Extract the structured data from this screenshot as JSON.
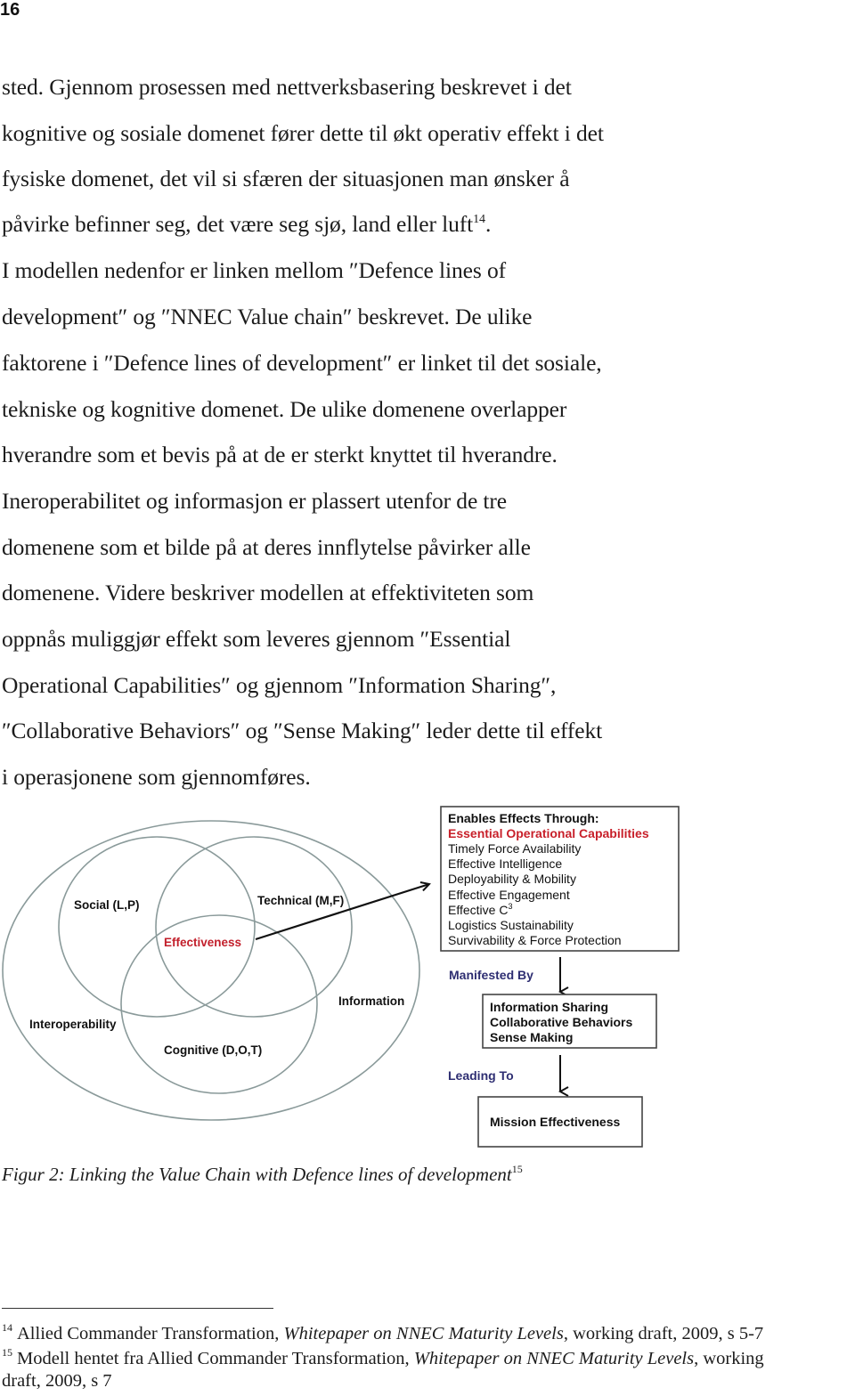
{
  "page": {
    "number": "16"
  },
  "body_lines": [
    "sted. Gjennom prosessen med nettverksbasering beskrevet i det",
    "kognitive og sosiale domenet fører dette til økt operativ effekt i det",
    "fysiske domenet, det vil si sfæren der situasjonen man ønsker å",
    "påvirke befinner seg, det være seg sjø, land eller luft",
    "I modellen nedenfor er linken mellom ″Defence lines of",
    "development″ og ″NNEC Value chain″ beskrevet. De ulike",
    "faktorene i ″Defence lines of development″ er linket til det sosiale,",
    "tekniske og kognitive domenet. De ulike domenene overlapper",
    "hverandre som et bevis på at de er sterkt knyttet til hverandre.",
    "Ineroperabilitet og informasjon er plassert utenfor de tre",
    "domenene som et bilde på at deres innflytelse påvirker alle",
    "domenene. Videre beskriver modellen at effektiviteten som",
    "oppnås muliggjør effekt som leveres gjennom ″Essential",
    "Operational Capabilities″ og gjennom ″Information Sharing″,",
    "″Collaborative Behaviors″ og ″Sense Making″ leder dette til effekt",
    "i operasjonene som gjennomføres."
  ],
  "body_footnote_ref": {
    "marker": "14",
    "after_text": "."
  },
  "figure": {
    "venn": {
      "social": "Social  (L,P)",
      "technical": "Technical (M,F)",
      "cognitive": "Cognitive (D,O,T)",
      "center": "Effectiveness",
      "outer_left": "Interoperability",
      "outer_right": "Information"
    },
    "capabilities_box": {
      "heading": "Enables Effects Through:",
      "subheading": "Essential Operational Capabilities",
      "items": [
        "Timely Force Availability",
        "Effective Intelligence",
        "Deployability & Mobility",
        "Effective Engagement",
        "Effective C",
        "Logistics Sustainability",
        "Survivability & Force Protection"
      ],
      "c3_superscript": "3"
    },
    "flow": {
      "manifested_label": "Manifested By",
      "manifested_items": [
        "Information Sharing",
        "Collaborative Behaviors",
        "Sense Making"
      ],
      "leading_label": "Leading To",
      "result": "Mission Effectiveness"
    },
    "colors": {
      "accent_red": "#c8202a",
      "label_navy": "#2e2e72",
      "circle_gray": "#8a9a9a"
    }
  },
  "caption": {
    "text": "Figur 2: Linking the Value Chain with Defence lines of development",
    "footnote_ref": "15"
  },
  "footnotes": [
    {
      "number": "14",
      "before": "Allied Commander Transformation, ",
      "title": "Whitepaper on NNEC Maturity Levels",
      "after": ", working draft, 2009, s 5-7"
    },
    {
      "number": "15",
      "before": "Modell hentet fra Allied Commander Transformation, ",
      "title": "Whitepaper on NNEC Maturity Levels",
      "after": ", working",
      "continuation": "draft, 2009, s 7"
    }
  ]
}
